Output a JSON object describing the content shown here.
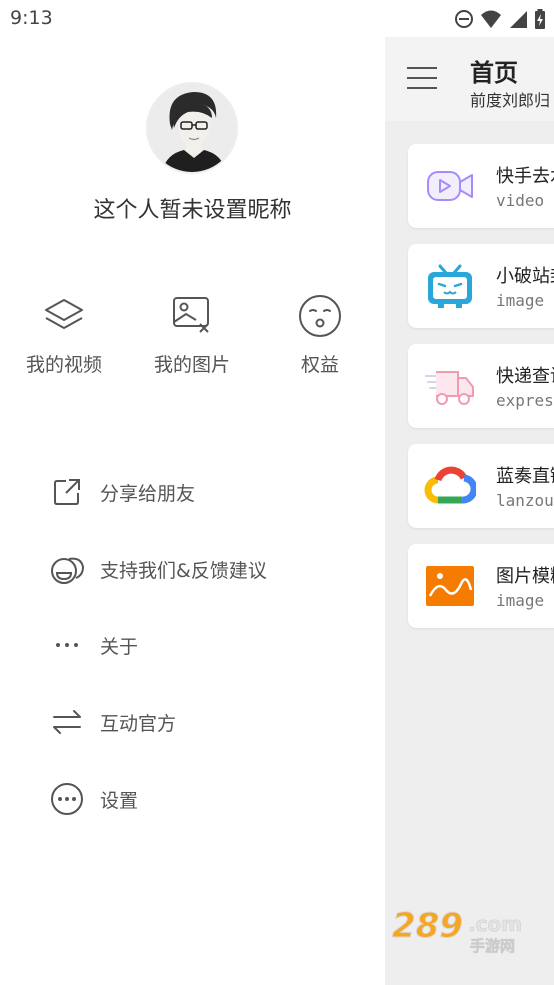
{
  "status_bar": {
    "time": "9:13",
    "icons": [
      "do-not-disturb-icon",
      "wifi-icon",
      "signal-icon",
      "battery-charging-icon"
    ]
  },
  "main": {
    "title": "首页",
    "subtitle": "前度刘郎归",
    "cards": [
      {
        "name": "快手去水",
        "sub": "video",
        "icon": "video-camera-icon",
        "color": "#a78bfa"
      },
      {
        "name": "小破站封",
        "sub": "image",
        "icon": "bilibili-tv-icon",
        "color": "#29a7d8"
      },
      {
        "name": "快递查询",
        "sub": "express",
        "icon": "delivery-truck-icon",
        "color": "#f19ab0"
      },
      {
        "name": "蓝奏直链",
        "sub": "lanzou",
        "icon": "google-cloud-icon",
        "color": "#4285f4"
      },
      {
        "name": "图片模糊",
        "sub": "image",
        "icon": "landscape-image-icon",
        "color": "#f57c00"
      }
    ]
  },
  "drawer": {
    "nickname": "这个人暂未设置昵称",
    "quick_actions": [
      {
        "label": "我的视频",
        "icon": "layers-icon"
      },
      {
        "label": "我的图片",
        "icon": "image-remove-icon"
      },
      {
        "label": "权益",
        "icon": "face-icon"
      }
    ],
    "menu": [
      {
        "label": "分享给朋友",
        "icon": "share-external-icon"
      },
      {
        "label": "支持我们&反馈建议",
        "icon": "feedback-icon"
      },
      {
        "label": "关于",
        "icon": "more-dots-icon"
      },
      {
        "label": "互动官方",
        "icon": "swap-arrows-icon"
      },
      {
        "label": "设置",
        "icon": "more-circle-icon"
      }
    ]
  },
  "watermark": {
    "text": "289",
    "suffix": ".com",
    "caption": "手游网"
  }
}
